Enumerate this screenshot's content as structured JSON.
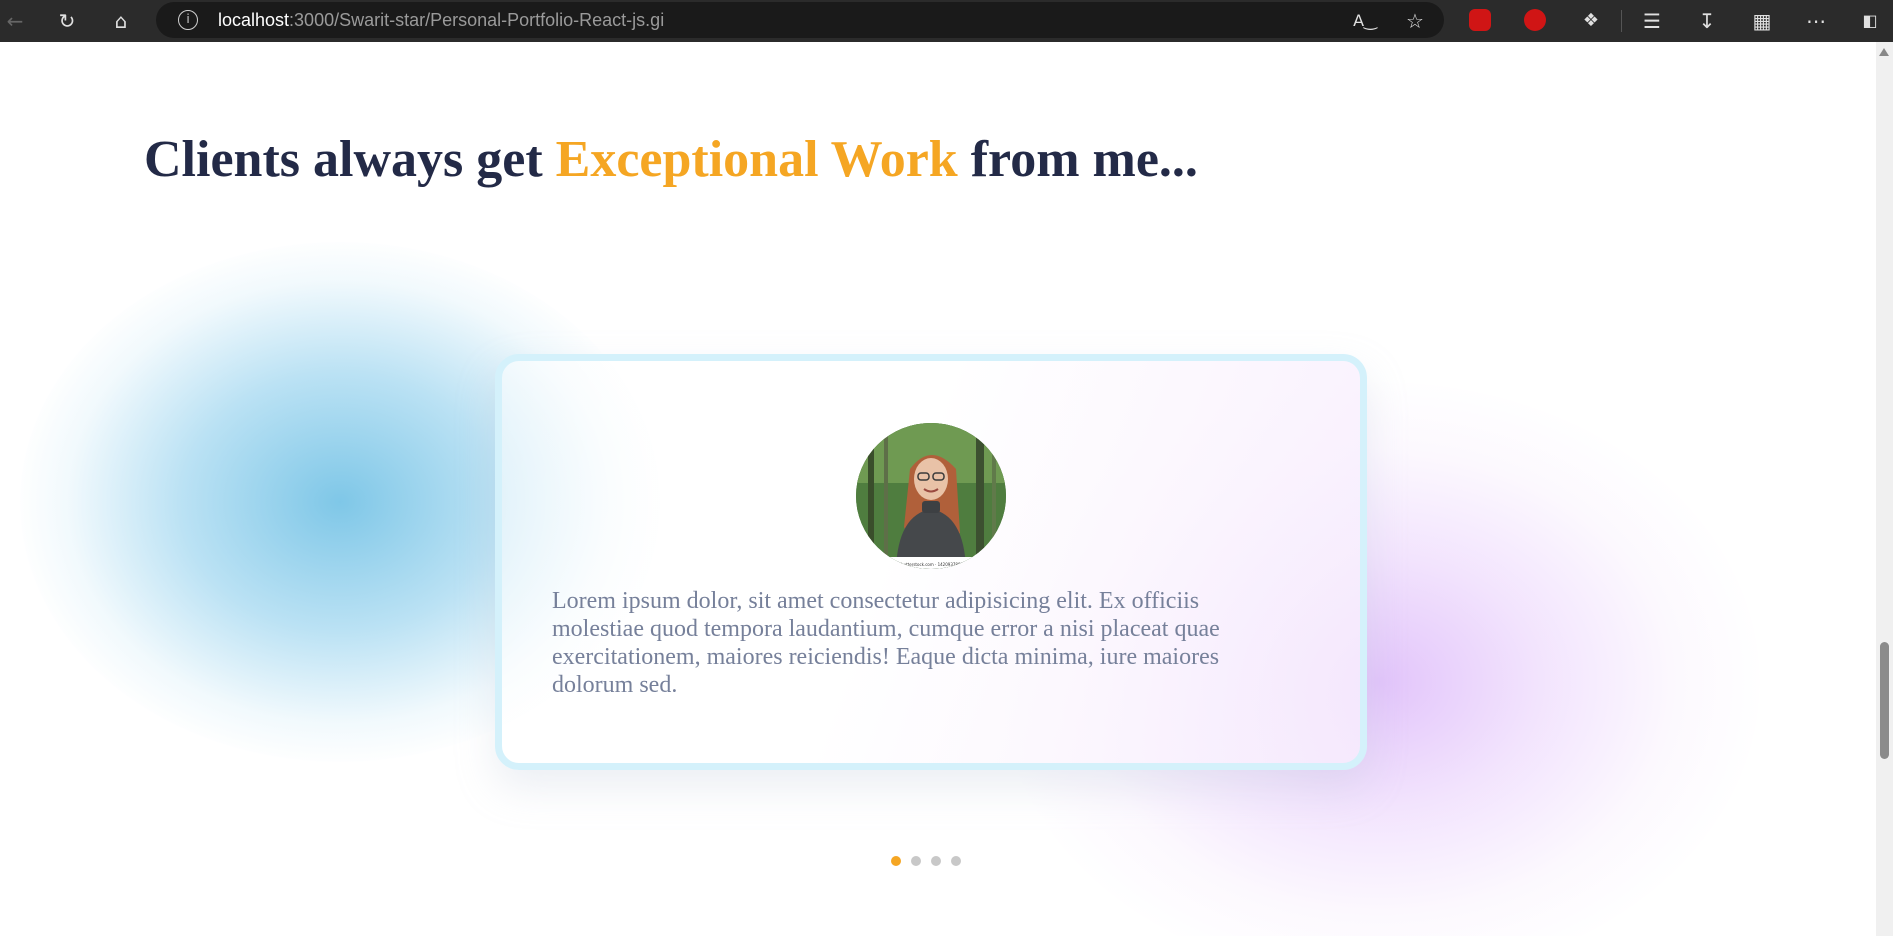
{
  "browser": {
    "url_host": "localhost",
    "url_rest": ":3000/Swarit-star/Personal-Portfolio-React-js.gi",
    "icons": [
      "back-icon",
      "refresh-icon",
      "home-icon",
      "site-info-icon",
      "read-aloud-icon",
      "favorite-star-icon",
      "extension-shield-icon",
      "extension-hand-icon",
      "extensions-puzzle-icon",
      "favorites-list-icon",
      "downloads-icon",
      "collections-icon",
      "more-icon",
      "sidebar-icon"
    ]
  },
  "section": {
    "heading_pre": "Clients always get ",
    "heading_accent": "Exceptional Work",
    "heading_post": " from me...",
    "accent_color": "#f5a623",
    "heading_color": "#232a47"
  },
  "testimonial": {
    "avatar_caption": "shutterstock.com · 1420937897",
    "text": "Lorem ipsum dolor, sit amet consectetur adipisicing elit. Ex officiis molestiae quod tempora laudantium, cumque error a nisi placeat quae exercitationem, maiores reiciendis! Eaque dicta minima, iure maiores dolorum sed."
  },
  "pagination": {
    "count": 4,
    "active_index": 0
  }
}
